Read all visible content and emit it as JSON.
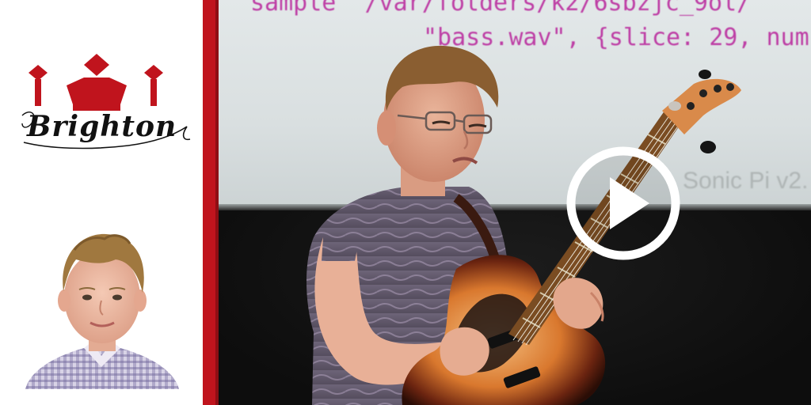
{
  "branding": {
    "logo_text": "Brighton",
    "logo_color": "#c0141d"
  },
  "video": {
    "screen_code_line_1": "sample \"/var/folders/k2/6sbzjc_9ol/",
    "screen_code_line_2": "\"bass.wav\", {slice: 29, num",
    "screen_label": "Sonic Pi v2.",
    "play_icon": "play-icon",
    "accent_color": "#ffffff"
  },
  "colors": {
    "divider": "#c0141d",
    "code_text": "#b8229a"
  }
}
